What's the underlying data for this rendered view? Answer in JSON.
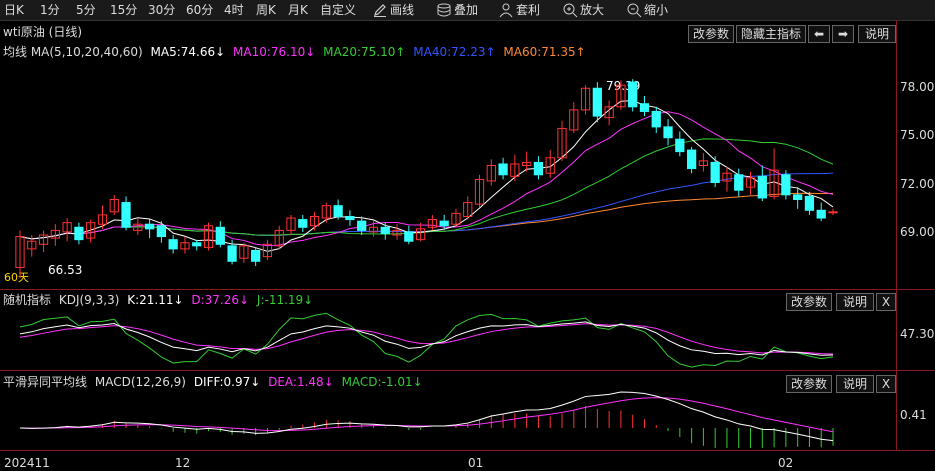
{
  "toolbar": {
    "periods": [
      "日K",
      "1分",
      "5分",
      "15分",
      "30分",
      "60分",
      "4时",
      "周K",
      "月K",
      "自定义"
    ],
    "active": "日K",
    "tools": [
      {
        "icon": "pencil-icon",
        "label": "画线"
      },
      {
        "icon": "stack-icon",
        "label": "叠加"
      },
      {
        "icon": "user-icon",
        "label": "套利"
      },
      {
        "icon": "zoom-in-icon",
        "label": "放大"
      },
      {
        "icon": "zoom-out-icon",
        "label": "缩小"
      }
    ]
  },
  "main": {
    "title": "wti原油 (日线)",
    "buttons": {
      "params": "改参数",
      "hide": "隐藏主指标",
      "left": "⬅",
      "right": "➡",
      "help": "说明"
    },
    "ma_label": "均线 MA(5,10,20,40,60)",
    "ma": [
      {
        "text": "MA5:74.66↓",
        "color": "#ffffff"
      },
      {
        "text": "MA10:76.10↓",
        "color": "#ff33ff"
      },
      {
        "text": "MA20:75.10↑",
        "color": "#33cc33"
      },
      {
        "text": "MA40:72.23↑",
        "color": "#3355ff"
      },
      {
        "text": "MA60:71.35↑",
        "color": "#ff8833"
      }
    ],
    "axis": [
      "78.00",
      "75.00",
      "72.00",
      "69.00"
    ],
    "high_label": "79.39",
    "low_label": "66.53",
    "corner_label": "60天"
  },
  "kdj": {
    "title": "随机指标",
    "params": "KDJ(9,3,3)",
    "k": {
      "text": "K:21.11↓",
      "color": "#ffffff"
    },
    "d": {
      "text": "D:37.26↓",
      "color": "#ff33ff"
    },
    "j": {
      "text": "J:-11.19↓",
      "color": "#33cc33"
    },
    "buttons": {
      "params": "改参数",
      "help": "说明",
      "close": "X"
    },
    "axis": [
      "47.30"
    ]
  },
  "macd": {
    "title": "平滑异同平均线",
    "params": "MACD(12,26,9)",
    "diff": {
      "text": "DIFF:0.97↓",
      "color": "#ffffff"
    },
    "dea": {
      "text": "DEA:1.48↓",
      "color": "#ff33ff"
    },
    "macd": {
      "text": "MACD:-1.01↓",
      "color": "#33cc33"
    },
    "buttons": {
      "params": "改参数",
      "help": "说明",
      "close": "X"
    },
    "axis": [
      "0.41"
    ]
  },
  "dates": [
    "202411",
    "12",
    "01",
    "02"
  ],
  "colors": {
    "up": "#ff3333",
    "down": "#33ffff",
    "bg": "#000000",
    "grid": "#8b1a1a"
  },
  "chart_data": {
    "type": "candlestick",
    "title": "wti原油 (日线)",
    "ylim": [
      66.0,
      80.5
    ],
    "candles": [
      [
        67.2,
        69.2,
        69.6,
        66.5
      ],
      [
        68.4,
        68.9,
        69.3,
        67.9
      ],
      [
        68.7,
        69.3,
        69.6,
        68.2
      ],
      [
        69.1,
        69.6,
        70.0,
        68.6
      ],
      [
        69.5,
        70.1,
        70.4,
        68.9
      ],
      [
        69.8,
        69.0,
        70.1,
        68.7
      ],
      [
        69.1,
        70.1,
        70.3,
        68.8
      ],
      [
        70.0,
        70.6,
        71.2,
        69.7
      ],
      [
        70.8,
        71.6,
        71.9,
        70.6
      ],
      [
        71.4,
        69.8,
        71.8,
        69.6
      ],
      [
        69.6,
        70.0,
        70.4,
        69.3
      ],
      [
        70.0,
        69.7,
        70.3,
        69.1
      ],
      [
        69.9,
        69.2,
        70.2,
        68.8
      ],
      [
        69.0,
        68.4,
        69.3,
        68.1
      ],
      [
        68.4,
        68.8,
        69.2,
        68.1
      ],
      [
        68.8,
        68.6,
        69.0,
        68.3
      ],
      [
        68.5,
        69.9,
        70.1,
        68.3
      ],
      [
        69.8,
        68.7,
        70.2,
        68.5
      ],
      [
        68.6,
        67.6,
        69.0,
        67.4
      ],
      [
        67.8,
        68.6,
        68.8,
        67.5
      ],
      [
        68.3,
        67.6,
        68.5,
        67.3
      ],
      [
        67.9,
        68.7,
        69.0,
        67.7
      ],
      [
        68.6,
        69.6,
        69.9,
        68.4
      ],
      [
        69.6,
        70.4,
        70.6,
        69.3
      ],
      [
        70.3,
        69.8,
        70.6,
        69.5
      ],
      [
        69.9,
        70.5,
        70.8,
        69.6
      ],
      [
        70.4,
        71.2,
        71.4,
        70.1
      ],
      [
        71.2,
        70.5,
        71.6,
        70.3
      ],
      [
        70.5,
        70.3,
        70.9,
        69.9
      ],
      [
        70.2,
        69.6,
        70.5,
        69.3
      ],
      [
        69.5,
        69.8,
        70.2,
        69.2
      ],
      [
        69.8,
        69.4,
        70.1,
        69.0
      ],
      [
        69.3,
        69.6,
        70.0,
        69.0
      ],
      [
        69.5,
        68.9,
        69.9,
        68.7
      ],
      [
        69.0,
        69.7,
        70.1,
        68.9
      ],
      [
        69.8,
        70.3,
        70.6,
        69.6
      ],
      [
        70.2,
        69.9,
        70.6,
        69.7
      ],
      [
        70.0,
        70.7,
        71.0,
        69.8
      ],
      [
        70.5,
        71.4,
        71.8,
        70.3
      ],
      [
        71.3,
        72.9,
        73.2,
        71.1
      ],
      [
        72.8,
        73.8,
        74.2,
        72.5
      ],
      [
        73.9,
        73.2,
        74.3,
        72.9
      ],
      [
        73.1,
        73.9,
        74.5,
        72.8
      ],
      [
        73.8,
        74.0,
        74.7,
        73.4
      ],
      [
        74.0,
        73.2,
        74.4,
        72.9
      ],
      [
        73.3,
        74.3,
        74.8,
        73.0
      ],
      [
        74.3,
        76.2,
        76.7,
        74.1
      ],
      [
        76.1,
        77.4,
        77.9,
        75.9
      ],
      [
        77.4,
        78.8,
        79.0,
        77.1
      ],
      [
        78.8,
        77.0,
        79.2,
        76.6
      ],
      [
        76.9,
        77.6,
        78.0,
        76.4
      ],
      [
        77.6,
        79.0,
        79.3,
        77.4
      ],
      [
        79.2,
        77.6,
        79.39,
        77.3
      ],
      [
        77.8,
        77.3,
        78.3,
        77.0
      ],
      [
        77.3,
        76.3,
        77.6,
        75.9
      ],
      [
        76.3,
        75.6,
        76.8,
        75.1
      ],
      [
        75.5,
        74.7,
        76.0,
        74.4
      ],
      [
        74.8,
        73.6,
        75.0,
        73.3
      ],
      [
        73.8,
        74.1,
        74.6,
        73.4
      ],
      [
        74.0,
        72.7,
        74.4,
        72.4
      ],
      [
        72.8,
        73.3,
        73.7,
        72.1
      ],
      [
        73.2,
        72.2,
        73.6,
        71.8
      ],
      [
        72.4,
        73.0,
        73.4,
        71.9
      ],
      [
        73.1,
        71.7,
        73.8,
        71.5
      ],
      [
        71.8,
        73.5,
        74.9,
        71.6
      ],
      [
        73.2,
        71.9,
        73.5,
        71.6
      ],
      [
        71.9,
        71.6,
        72.4,
        71.0
      ],
      [
        71.8,
        70.9,
        72.1,
        70.6
      ],
      [
        70.9,
        70.4,
        71.4,
        70.2
      ],
      [
        70.8,
        70.8,
        71.0,
        70.6
      ]
    ],
    "ma_values": {
      "MA5": 74.66,
      "MA10": 76.1,
      "MA20": 75.1,
      "MA40": 72.23,
      "MA60": 71.35
    },
    "kdj_values": {
      "K": 21.11,
      "D": 37.26,
      "J": -11.19
    },
    "macd_values": {
      "DIFF": 0.97,
      "DEA": 1.48,
      "MACD": -1.01
    },
    "x_ticks": [
      "202411",
      "12",
      "01",
      "02"
    ]
  }
}
